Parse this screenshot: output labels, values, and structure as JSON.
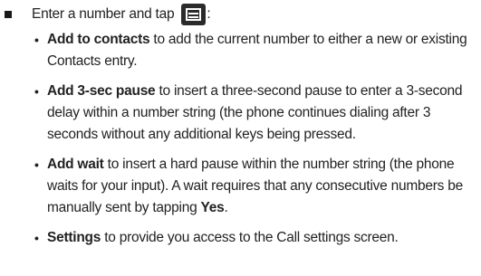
{
  "intro": {
    "text": "Enter a number and tap",
    "icon": "menu-key-icon",
    "suffix": ":"
  },
  "items": [
    {
      "term": "Add to contacts",
      "desc": " to add the current number to either a new or existing Contacts entry."
    },
    {
      "term": "Add 3-sec pause",
      "desc": " to insert a three-second pause to enter a 3-second delay within a number string (the phone continues dialing after 3 seconds without any additional keys being pressed."
    },
    {
      "term": "Add wait",
      "desc": " to insert a hard pause within the number string (the phone waits for your input). A wait requires that any consecutive numbers be manually sent by tapping ",
      "emphasis": "Yes",
      "end": "."
    },
    {
      "term": "Settings",
      "desc": " to provide you access to the Call settings screen."
    }
  ]
}
